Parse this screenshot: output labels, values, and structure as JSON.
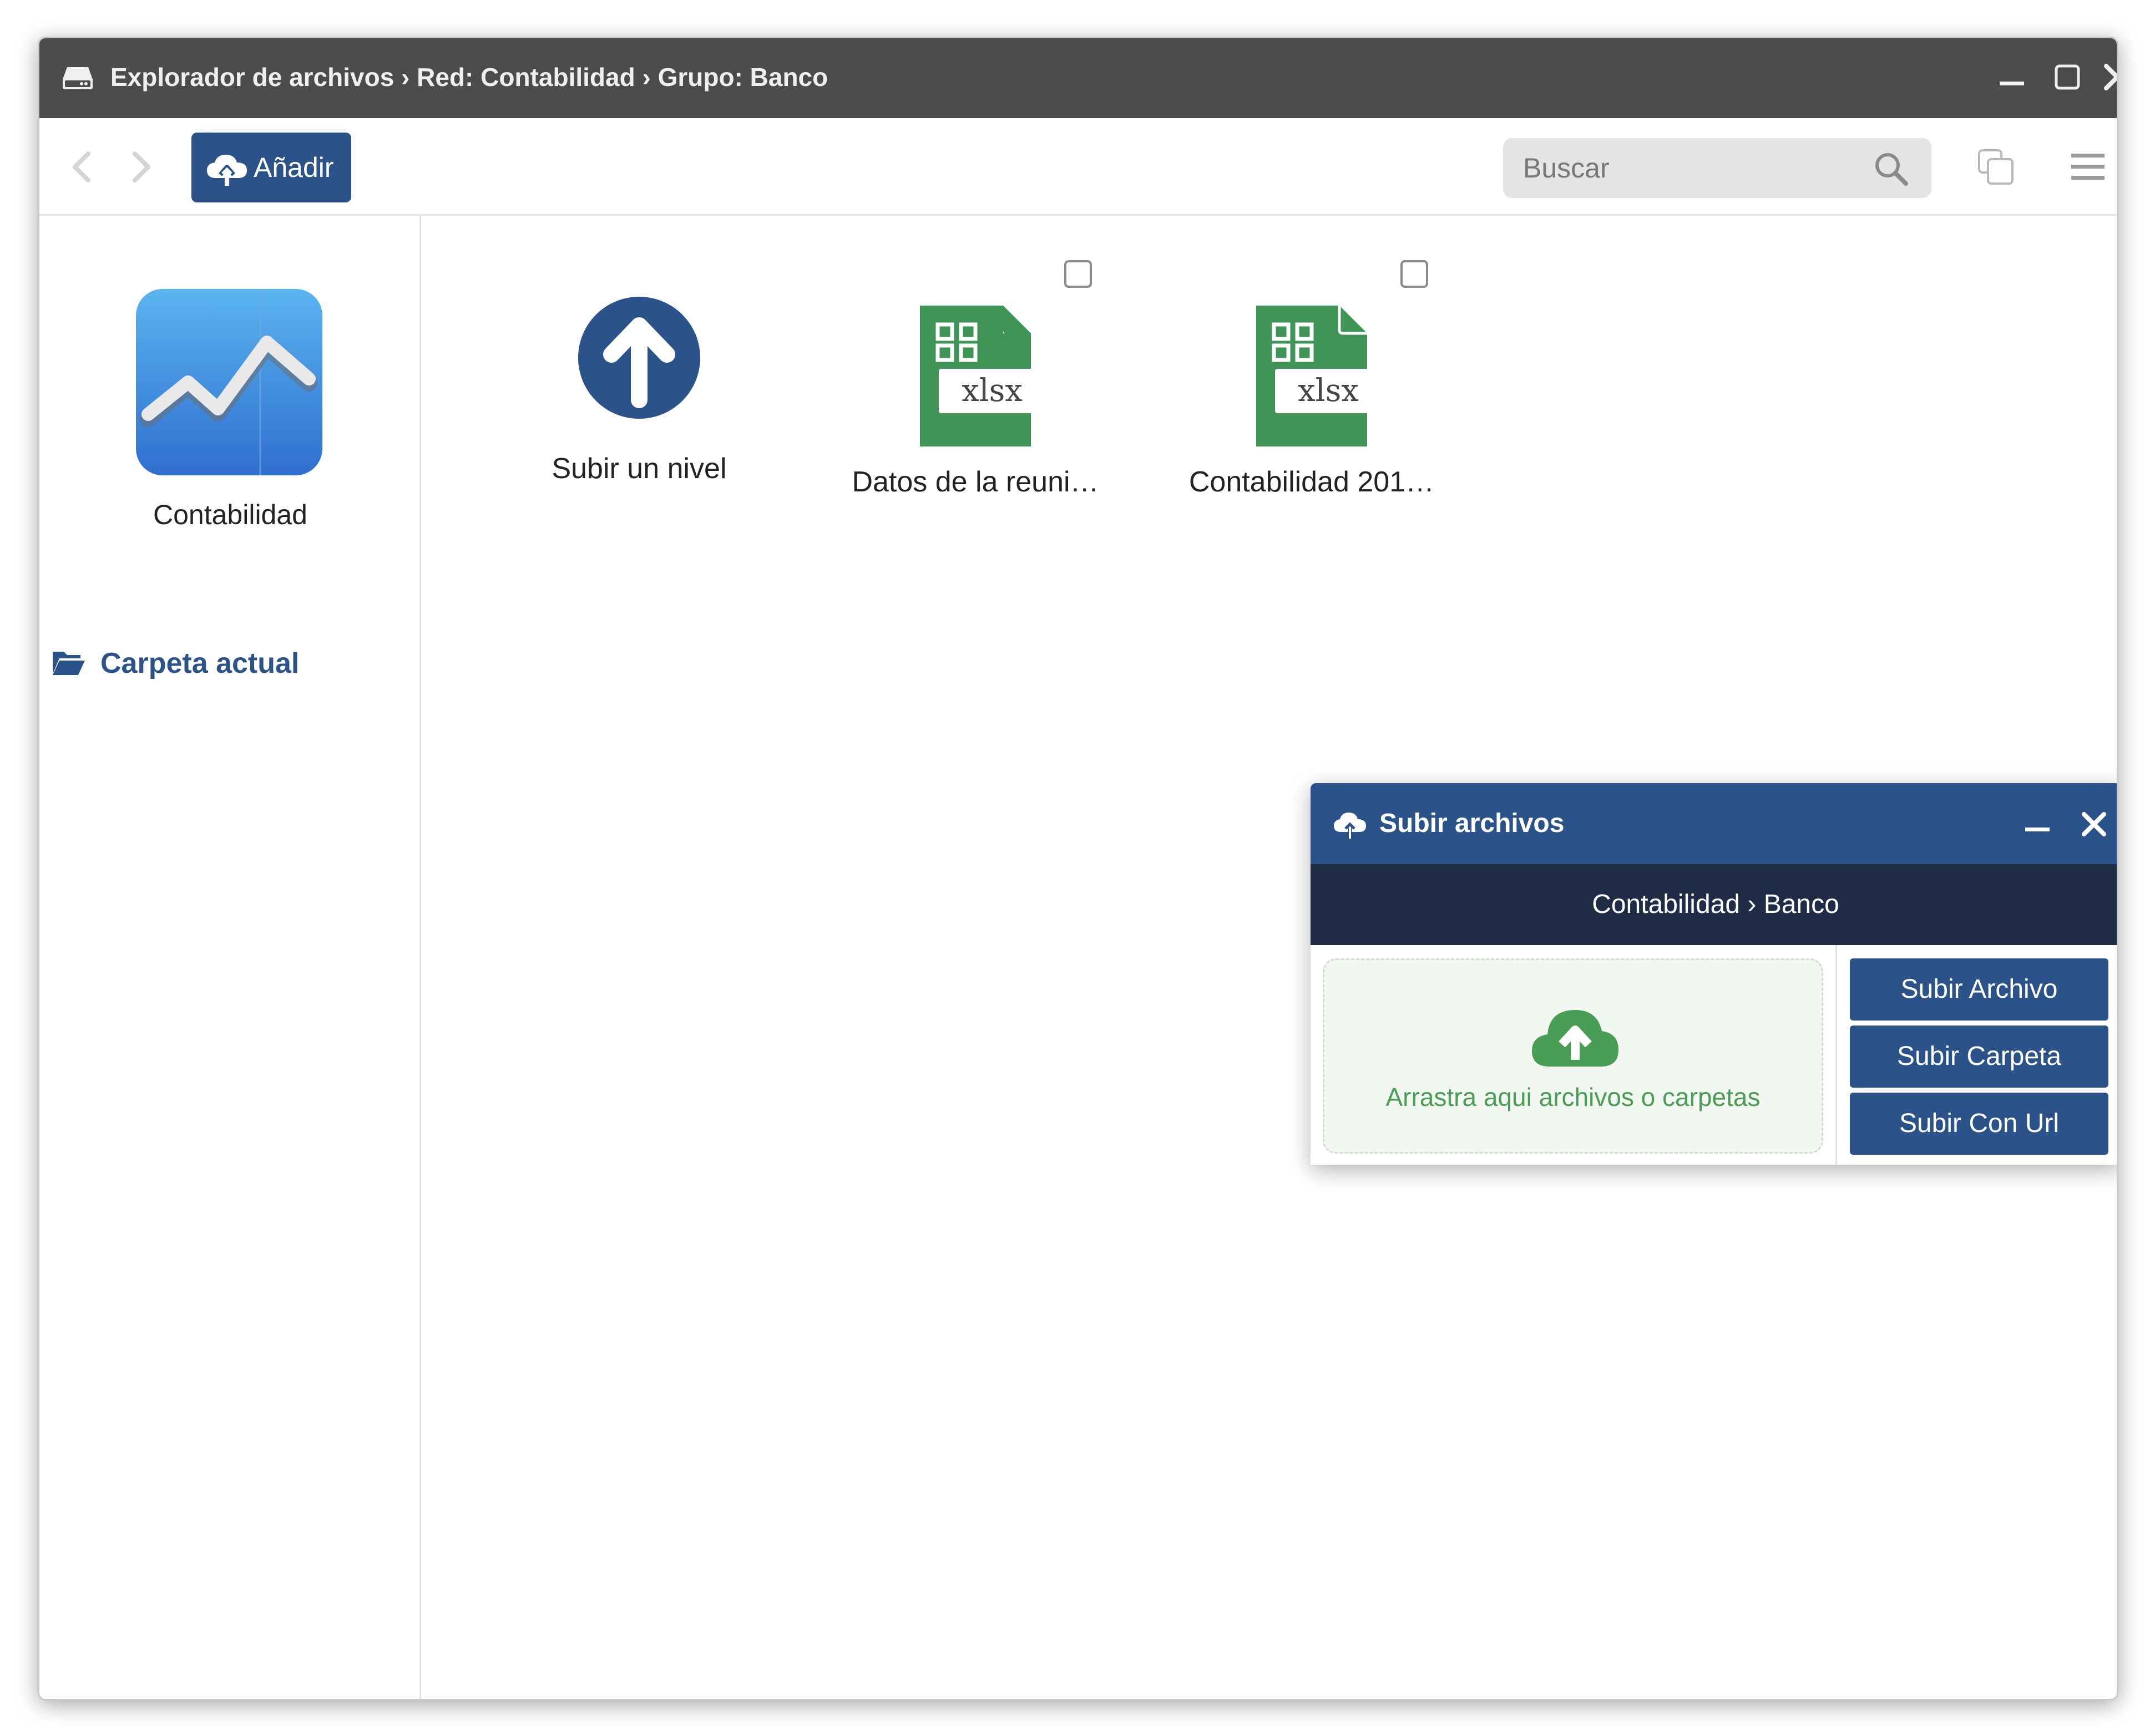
{
  "window": {
    "title": "Explorador de archivos › Red: Contabilidad › Grupo: Banco"
  },
  "toolbar": {
    "add_label": "Añadir",
    "search_placeholder": "Buscar"
  },
  "sidebar": {
    "app_name": "Contabilidad",
    "current_folder_label": "Carpeta actual"
  },
  "files": [
    {
      "name": "Subir un nivel",
      "type": "up-level"
    },
    {
      "name": "Datos de la reuni…",
      "type": "xlsx",
      "checked": false
    },
    {
      "name": "Contabilidad 201…",
      "type": "xlsx",
      "checked": false
    }
  ],
  "file_icon_text": "xlsx",
  "upload_dialog": {
    "title": "Subir archivos",
    "path": "Contabilidad › Banco",
    "drop_text": "Arrastra aqui archivos o carpetas",
    "buttons": [
      "Subir Archivo",
      "Subir Carpeta",
      "Subir Con Url"
    ]
  },
  "colors": {
    "titlebar": "#4b4b4b",
    "accent_blue": "#2b5389",
    "dialog_path_bg": "#1e2d45",
    "excel_green": "#3f9456",
    "drop_green": "#4a9d55"
  }
}
